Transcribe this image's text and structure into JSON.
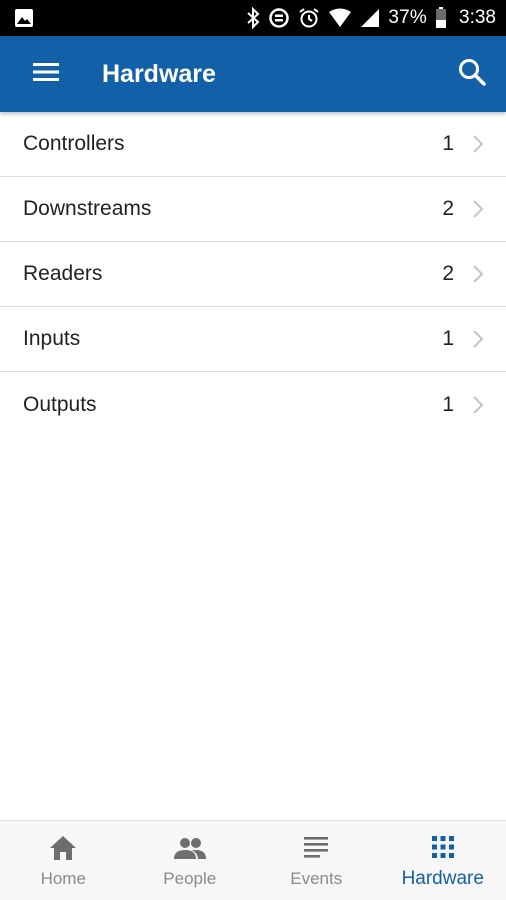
{
  "status_bar": {
    "battery_percent": "37%",
    "time": "3:38",
    "icons": [
      "image-icon",
      "bluetooth-icon",
      "data-saver-icon",
      "alarm-icon",
      "wifi-icon",
      "signal-icon",
      "battery-icon"
    ]
  },
  "app_bar": {
    "title": "Hardware",
    "menu_icon": "menu-icon",
    "search_icon": "search-icon",
    "color": "#1261a8"
  },
  "list": {
    "items": [
      {
        "label": "Controllers",
        "count": "1"
      },
      {
        "label": "Downstreams",
        "count": "2"
      },
      {
        "label": "Readers",
        "count": "2"
      },
      {
        "label": "Inputs",
        "count": "1"
      },
      {
        "label": "Outputs",
        "count": "1"
      }
    ]
  },
  "bottom_nav": {
    "tabs": [
      {
        "label": "Home",
        "icon": "home-icon",
        "active": false
      },
      {
        "label": "People",
        "icon": "people-icon",
        "active": false
      },
      {
        "label": "Events",
        "icon": "events-list-icon",
        "active": false
      },
      {
        "label": "Hardware",
        "icon": "grid-icon",
        "active": true
      }
    ],
    "active_color": "#1261a8",
    "inactive_color": "#8a8a8a"
  }
}
